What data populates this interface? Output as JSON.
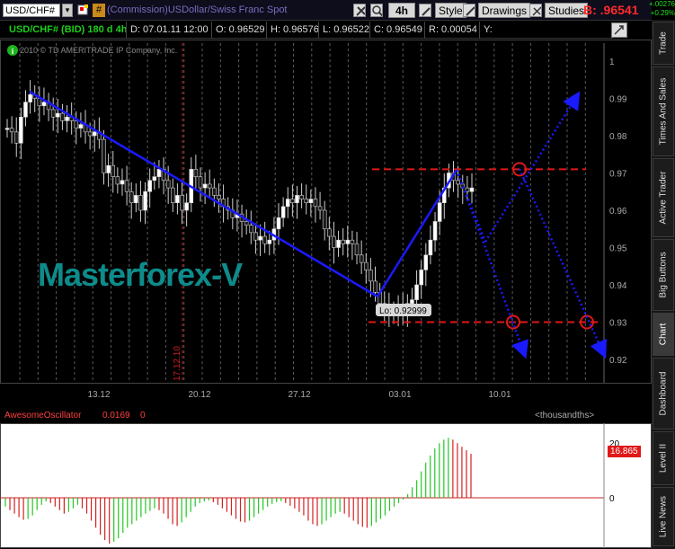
{
  "toolbar": {
    "symbol": "USD/CHF#",
    "description": "(Commission)USDollar/Swiss Franc Spot",
    "timeframe": "4h",
    "style_label": "Style",
    "drawings_label": "Drawings",
    "studies_label": "Studies",
    "bid": "B: .96541",
    "change_abs": "+.00276",
    "change_pct": "+0.29%"
  },
  "info_bar": {
    "symbol_period": "USD/CHF# (BID) 180 d 4h",
    "date": "D: 07.01.11 12:00",
    "open": "O: 0.96529",
    "high": "H: 0.96576",
    "low": "L: 0.96522",
    "close": "C: 0.96549",
    "range": "R: 0.00054",
    "y": "Y:"
  },
  "watermark": "2010 © TD AMERITRADE IP Company, Inc.",
  "brand": "Masterforex-V",
  "vertical_marker": "17.12.10",
  "low_label": "Lo: 0.92999",
  "price_axis": [
    "1",
    "0.99",
    "0.98",
    "0.97",
    "0.96",
    "0.95",
    "0.94",
    "0.93",
    "0.92"
  ],
  "time_axis": [
    "13.12",
    "20.12",
    "27.12",
    "03.01",
    "10.01"
  ],
  "oscillator": {
    "name": "AwesomeOscillator",
    "value": "0.0169",
    "value2": "0",
    "units": "<thousandths>",
    "axis": [
      "20",
      "0"
    ],
    "badge": "16.865"
  },
  "right_tabs": [
    "Trade",
    "Times And Sales",
    "Active Trader",
    "Big Buttons",
    "Chart",
    "Dashboard",
    "Level II",
    "Live News"
  ],
  "colors": {
    "bid": "#ff2a2a",
    "trendline": "#1a1aff",
    "level": "#e01818",
    "brand": "#0e8b8b",
    "osc_up": "#22c722",
    "osc_down": "#d42020"
  },
  "chart_data": {
    "type": "candlestick",
    "ylim": [
      0.92,
      1.0
    ],
    "candles_close": [
      0.982,
      0.981,
      0.978,
      0.985,
      0.989,
      0.991,
      0.99,
      0.988,
      0.989,
      0.987,
      0.985,
      0.986,
      0.984,
      0.985,
      0.984,
      0.982,
      0.983,
      0.981,
      0.98,
      0.981,
      0.979,
      0.97,
      0.972,
      0.969,
      0.967,
      0.968,
      0.965,
      0.962,
      0.964,
      0.96,
      0.965,
      0.968,
      0.969,
      0.971,
      0.968,
      0.966,
      0.962,
      0.964,
      0.96,
      0.962,
      0.971,
      0.969,
      0.966,
      0.967,
      0.966,
      0.964,
      0.963,
      0.961,
      0.96,
      0.958,
      0.959,
      0.957,
      0.956,
      0.954,
      0.952,
      0.953,
      0.951,
      0.952,
      0.955,
      0.958,
      0.961,
      0.963,
      0.962,
      0.964,
      0.963,
      0.962,
      0.963,
      0.961,
      0.96,
      0.955,
      0.953,
      0.95,
      0.952,
      0.951,
      0.952,
      0.951,
      0.948,
      0.946,
      0.944,
      0.941,
      0.938,
      0.935,
      0.934,
      0.933,
      0.932,
      0.934,
      0.933,
      0.935,
      0.936,
      0.94,
      0.944,
      0.948,
      0.952,
      0.957,
      0.962,
      0.966,
      0.97,
      0.968,
      0.967,
      0.966,
      0.965,
      0.966
    ],
    "low": 0.92999,
    "resistance": 0.971,
    "support": 0.93
  }
}
